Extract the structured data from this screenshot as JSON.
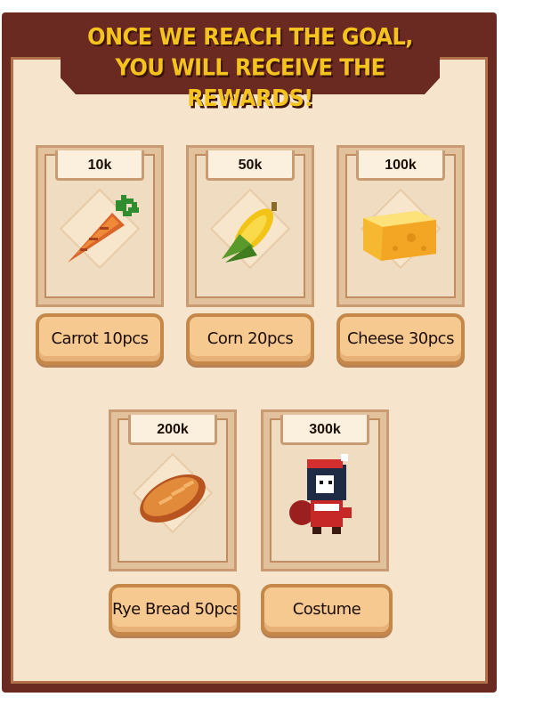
{
  "banner": {
    "line1": "ONCE WE REACH THE GOAL,",
    "line2": "YOU WILL RECEIVE THE REWARDS!"
  },
  "rewards": [
    {
      "goal": "10k",
      "label": "Carrot 10pcs",
      "icon": "carrot-icon"
    },
    {
      "goal": "50k",
      "label": "Corn 20pcs",
      "icon": "corn-icon"
    },
    {
      "goal": "100k",
      "label": "Cheese 30pcs",
      "icon": "cheese-icon"
    },
    {
      "goal": "200k",
      "label": "Rye Bread 50pcs",
      "icon": "bread-icon"
    },
    {
      "goal": "300k",
      "label": "Costume",
      "icon": "costume-character-icon"
    }
  ],
  "colors": {
    "frame": "#6b2a21",
    "banner_text": "#f5c31d",
    "panel": "#f6e5cc",
    "button": "#f6c991"
  }
}
